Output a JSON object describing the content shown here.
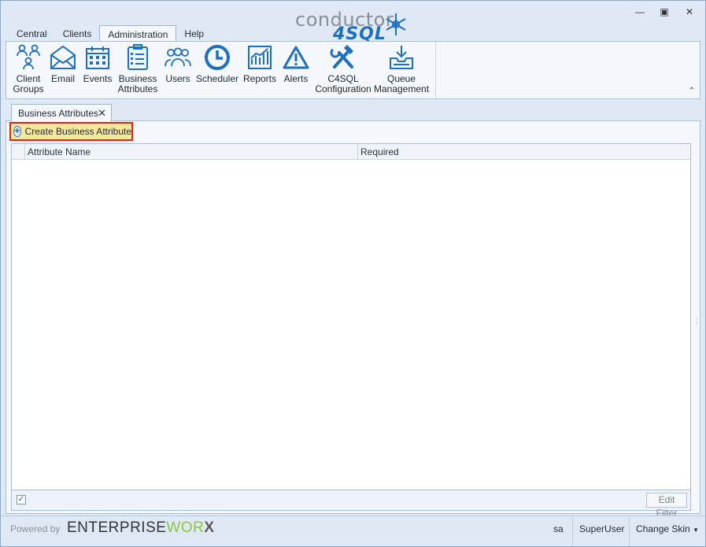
{
  "window": {
    "tabs": [
      {
        "label": "Central"
      },
      {
        "label": "Clients"
      },
      {
        "label": "Administration",
        "active": true
      },
      {
        "label": "Help"
      }
    ],
    "logo": {
      "line1": "conductor",
      "line2": "4SQL",
      "brand_color": "#1d6fc0"
    }
  },
  "ribbon": {
    "buttons": [
      {
        "label": "Client\nGroups",
        "icon": "client-groups-icon"
      },
      {
        "label": "Email",
        "icon": "email-icon"
      },
      {
        "label": "Events",
        "icon": "calendar-icon"
      },
      {
        "label": "Business\nAttributes",
        "icon": "clipboard-list-icon"
      },
      {
        "label": "Users",
        "icon": "users-icon"
      },
      {
        "label": "Scheduler",
        "icon": "clock-icon"
      },
      {
        "label": "Reports",
        "icon": "chart-report-icon"
      },
      {
        "label": "Alerts",
        "icon": "warning-icon"
      },
      {
        "label": "C4SQL\nConfiguration",
        "icon": "tools-icon"
      },
      {
        "label": "Queue\nManagement",
        "icon": "inbox-tray-icon"
      }
    ]
  },
  "document_tab": {
    "label": "Business Attributes"
  },
  "toolbar": {
    "create_label": "Create Business Attribute"
  },
  "grid": {
    "columns": [
      "Attribute Name",
      "Required"
    ],
    "rows": []
  },
  "grid_footer": {
    "edit_filter_label": "Edit Filter",
    "filter_checked": true
  },
  "statusbar": {
    "powered_by": "Powered by",
    "vendor_a": "ENTERPRISE",
    "vendor_b": "WOR",
    "vendor_c": "X",
    "user": "sa",
    "role": "SuperUser",
    "skin_label": "Change Skin"
  },
  "colors": {
    "highlight_border": "#d8261e",
    "highlight_fill": "#f6e79c",
    "accent": "#1d6fc0"
  }
}
